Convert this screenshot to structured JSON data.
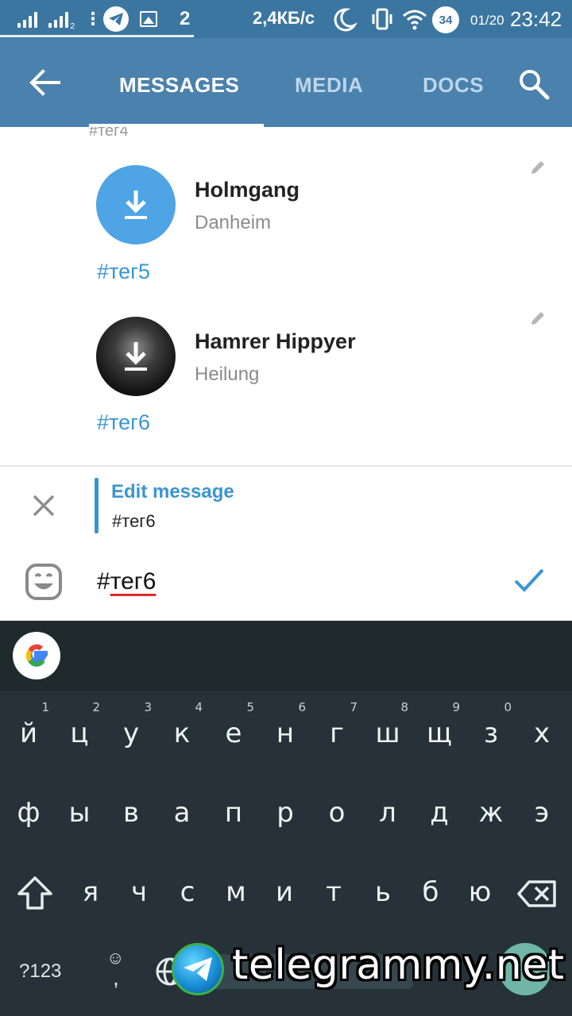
{
  "status_bar": {
    "notification_count": "2",
    "network_speed": "2,4КБ/с",
    "battery": "34",
    "date": "01/20",
    "time": "23:42",
    "sim2_label": "2"
  },
  "app_bar": {
    "tabs": [
      {
        "label": "MESSAGES",
        "active": true
      },
      {
        "label": "MEDIA",
        "active": false
      },
      {
        "label": "DOCS",
        "active": false
      }
    ],
    "back_icon": "arrow-left-icon",
    "search_icon": "search-icon",
    "colors": {
      "bar": "#4a81ad",
      "status": "#3b76a1",
      "accent": "#3a95d2"
    }
  },
  "messages": {
    "cutoff_text": "#тег4",
    "items": [
      {
        "title": "Holmgang",
        "artist": "Danheim",
        "tag": "#тег5",
        "avatar": "download-icon"
      },
      {
        "title": "Hamrer Hippyer",
        "artist": "Heilung",
        "tag": "#тег6",
        "avatar": "download-icon"
      }
    ]
  },
  "edit_panel": {
    "title": "Edit message",
    "text": "#тег6"
  },
  "input": {
    "hash": "#",
    "word": "тег6"
  },
  "keyboard": {
    "row1": [
      {
        "k": "й",
        "n": "1"
      },
      {
        "k": "ц",
        "n": "2"
      },
      {
        "k": "у",
        "n": "3"
      },
      {
        "k": "к",
        "n": "4"
      },
      {
        "k": "е",
        "n": "5"
      },
      {
        "k": "н",
        "n": "6"
      },
      {
        "k": "г",
        "n": "7"
      },
      {
        "k": "ш",
        "n": "8"
      },
      {
        "k": "щ",
        "n": "9"
      },
      {
        "k": "з",
        "n": "0"
      },
      {
        "k": "х",
        "n": ""
      }
    ],
    "row2": [
      "ф",
      "ы",
      "в",
      "а",
      "п",
      "р",
      "о",
      "л",
      "д",
      "ж",
      "э"
    ],
    "row3": [
      "я",
      "ч",
      "с",
      "м",
      "и",
      "т",
      "ь",
      "б",
      "ю"
    ],
    "symbols_key": "?123",
    "emoji_key": "☺",
    "comma_key": ","
  },
  "watermark": {
    "text": "telegrammy.net"
  }
}
